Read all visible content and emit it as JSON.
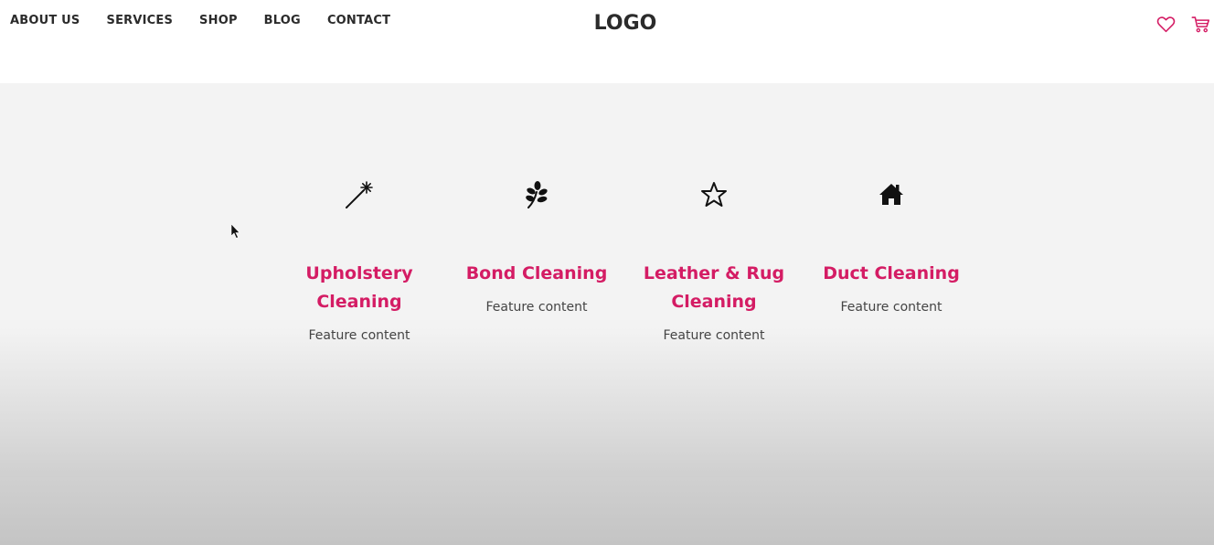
{
  "nav": {
    "items": [
      {
        "label": "ABOUT US"
      },
      {
        "label": "SERVICES"
      },
      {
        "label": "SHOP"
      },
      {
        "label": "BLOG"
      },
      {
        "label": "CONTACT"
      }
    ]
  },
  "logo": {
    "text": "LOGO"
  },
  "header_icons": [
    {
      "icon": "heart-icon"
    },
    {
      "icon": "cart-icon"
    }
  ],
  "features": [
    {
      "icon": "magic-wand-icon",
      "title": "Upholstery Cleaning",
      "content": "Feature content"
    },
    {
      "icon": "leaf-icon",
      "title": "Bond Cleaning",
      "content": "Feature content"
    },
    {
      "icon": "star-icon",
      "title": "Leather & Rug Cleaning",
      "content": "Feature content"
    },
    {
      "icon": "home-icon",
      "title": "Duct Cleaning",
      "content": "Feature content"
    }
  ],
  "colors": {
    "accent": "#d41c64",
    "text_dark": "#2b2b2b",
    "text_body": "#444444",
    "band_background": "#f3f3f3"
  }
}
